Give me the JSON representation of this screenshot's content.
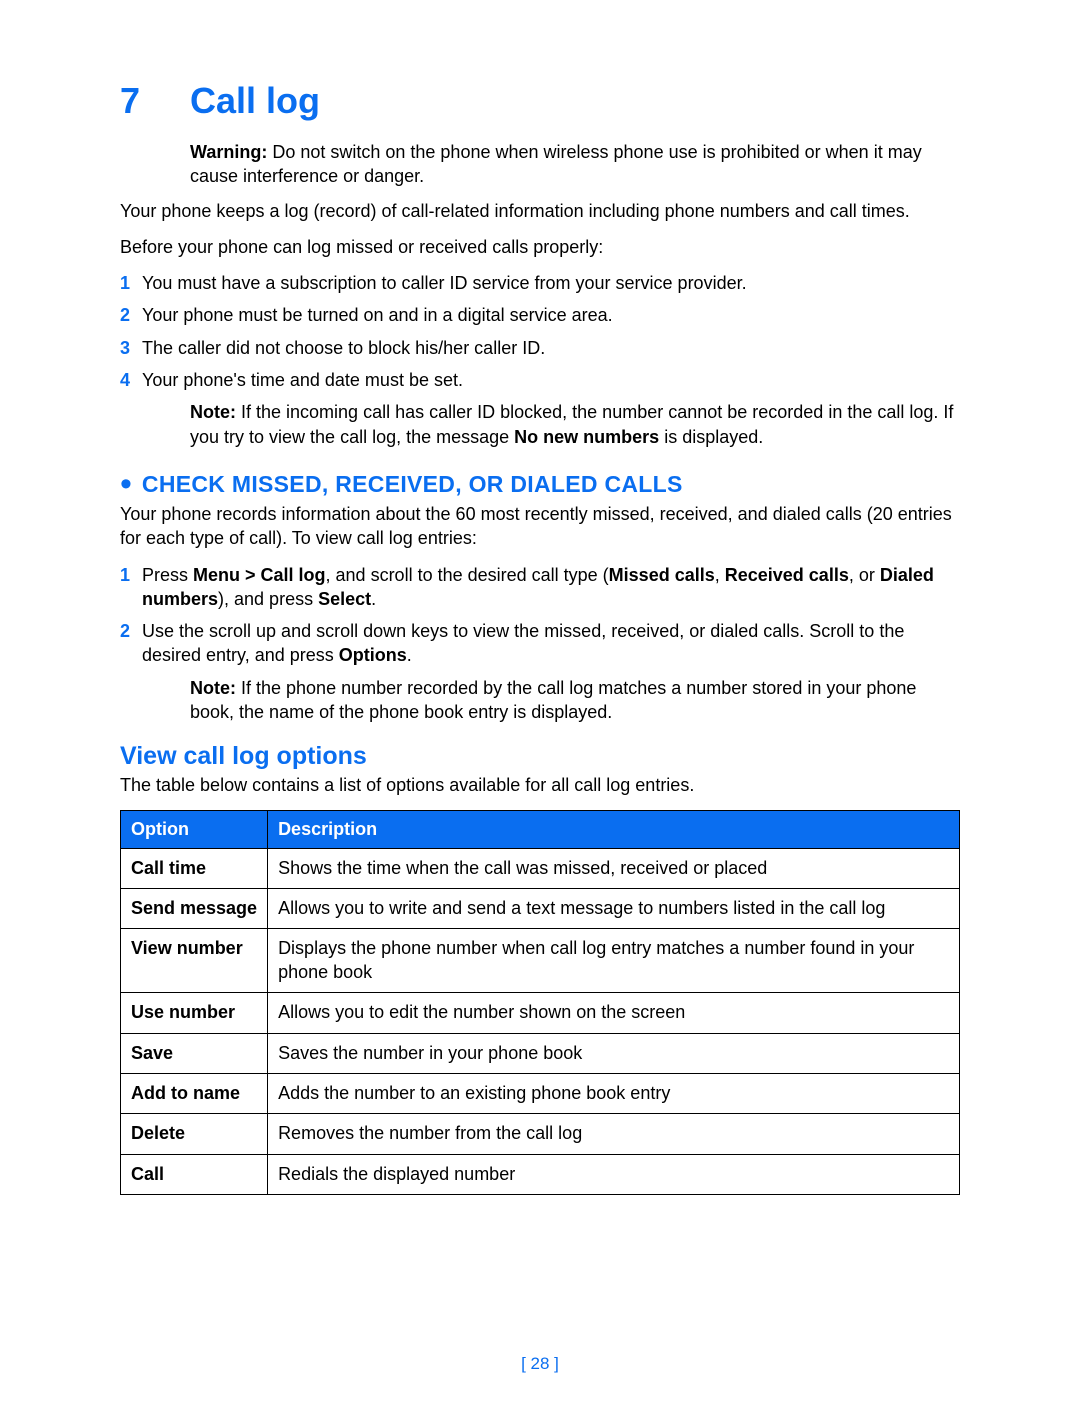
{
  "chapter": {
    "number": "7",
    "title": "Call log"
  },
  "warning": {
    "label": "Warning:",
    "text": " Do not switch on the phone when wireless phone use is prohibited or when it may cause interference or danger."
  },
  "intro": [
    "Your phone keeps a log (record) of call-related information including phone numbers and call times.",
    "Before your phone can log missed or received calls properly:"
  ],
  "prereqs": [
    "You must have a subscription to caller ID service from your service provider.",
    "Your phone must be turned on and in a digital service area.",
    "The caller did not choose to block his/her caller ID.",
    "Your phone's time and date must be set."
  ],
  "note1": {
    "label": "Note:",
    "part1": " If the incoming call has caller ID blocked, the number cannot be recorded in the call log. If you try to view the call log, the message ",
    "bold": "No new numbers",
    "part2": " is displayed."
  },
  "section": {
    "title": "CHECK MISSED, RECEIVED, OR DIALED CALLS",
    "intro": "Your phone records information about the 60 most recently missed, received, and dialed calls (20 entries for each type of call). To view call log entries:",
    "step1": {
      "a": "Press ",
      "b": "Menu > Call log",
      "c": ", and scroll to the desired call type (",
      "d": "Missed calls",
      "e": ", ",
      "f": "Received calls",
      "g": ", or ",
      "h": "Dialed numbers",
      "i": "), and press ",
      "j": "Select",
      "k": "."
    },
    "step2": {
      "a": "Use the scroll up and scroll down keys to view the missed, received, or dialed calls. Scroll to the desired entry, and press ",
      "b": "Options",
      "c": "."
    },
    "note2": {
      "label": "Note:",
      "text": " If the phone number recorded by the call log matches a number stored in your phone book, the name of the phone book entry is displayed."
    }
  },
  "subsection": {
    "title": "View call log options",
    "intro": "The table below contains a list of options available for all call log entries."
  },
  "table": {
    "headers": {
      "option": "Option",
      "description": "Description"
    },
    "rows": [
      {
        "option": "Call time",
        "description": "Shows the time when the call was missed, received or placed"
      },
      {
        "option": "Send message",
        "description": "Allows you to write and send a text message to numbers listed in the call log"
      },
      {
        "option": "View number",
        "description": "Displays the phone number when call log entry matches a number found in your phone book"
      },
      {
        "option": "Use number",
        "description": "Allows you to edit the number shown on the screen"
      },
      {
        "option": "Save",
        "description": "Saves the number in your phone book"
      },
      {
        "option": "Add to name",
        "description": "Adds the number to an existing phone book entry"
      },
      {
        "option": "Delete",
        "description": "Removes the number from the call log"
      },
      {
        "option": "Call",
        "description": "Redials the displayed number"
      }
    ]
  },
  "page_number": "[ 28 ]"
}
